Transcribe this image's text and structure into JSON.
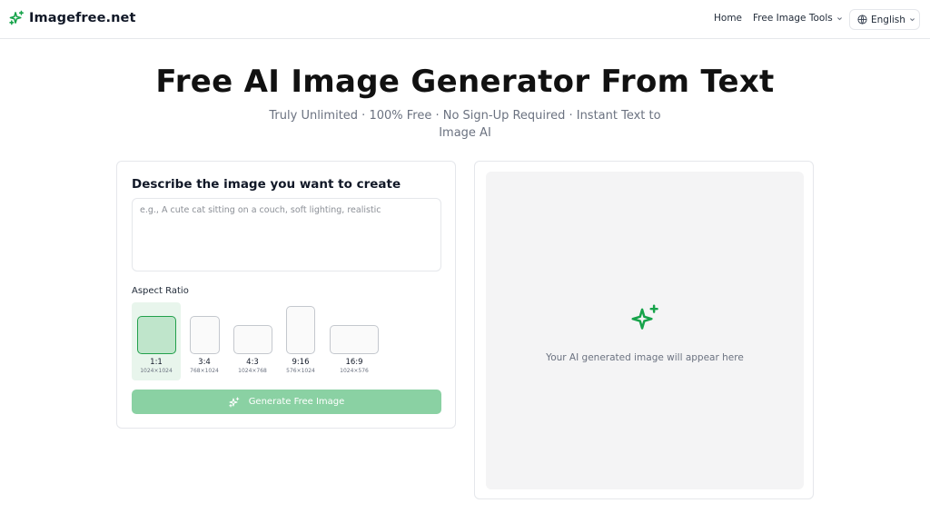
{
  "header": {
    "brand_name": "Imagefree.net",
    "brand_icon": "sparkles-icon",
    "nav_home": "Home",
    "nav_tools": "Free Image Tools",
    "language": "English"
  },
  "hero": {
    "title": "Free AI Image Generator From Text",
    "subtitle": "Truly Unlimited · 100% Free · No Sign-Up Required · Instant Text to Image AI"
  },
  "generator": {
    "heading": "Describe the image you want to create",
    "prompt_value": "",
    "prompt_placeholder": "e.g., A cute cat sitting on a couch, soft lighting, realistic",
    "aspect_label": "Aspect Ratio",
    "ratios": [
      {
        "name": "1:1",
        "size": "1024×1024",
        "selected": true
      },
      {
        "name": "3:4",
        "size": "768×1024",
        "selected": false
      },
      {
        "name": "4:3",
        "size": "1024×768",
        "selected": false
      },
      {
        "name": "9:16",
        "size": "576×1024",
        "selected": false
      },
      {
        "name": "16:9",
        "size": "1024×576",
        "selected": false
      }
    ],
    "generate_label": "Generate Free Image"
  },
  "preview": {
    "placeholder_text": "Your AI generated image will appear here",
    "icon": "sparkles-icon"
  },
  "colors": {
    "accent": "#22a04b",
    "button_disabled": "#8ad1a3",
    "selected_bg": "#e8f5ec"
  }
}
